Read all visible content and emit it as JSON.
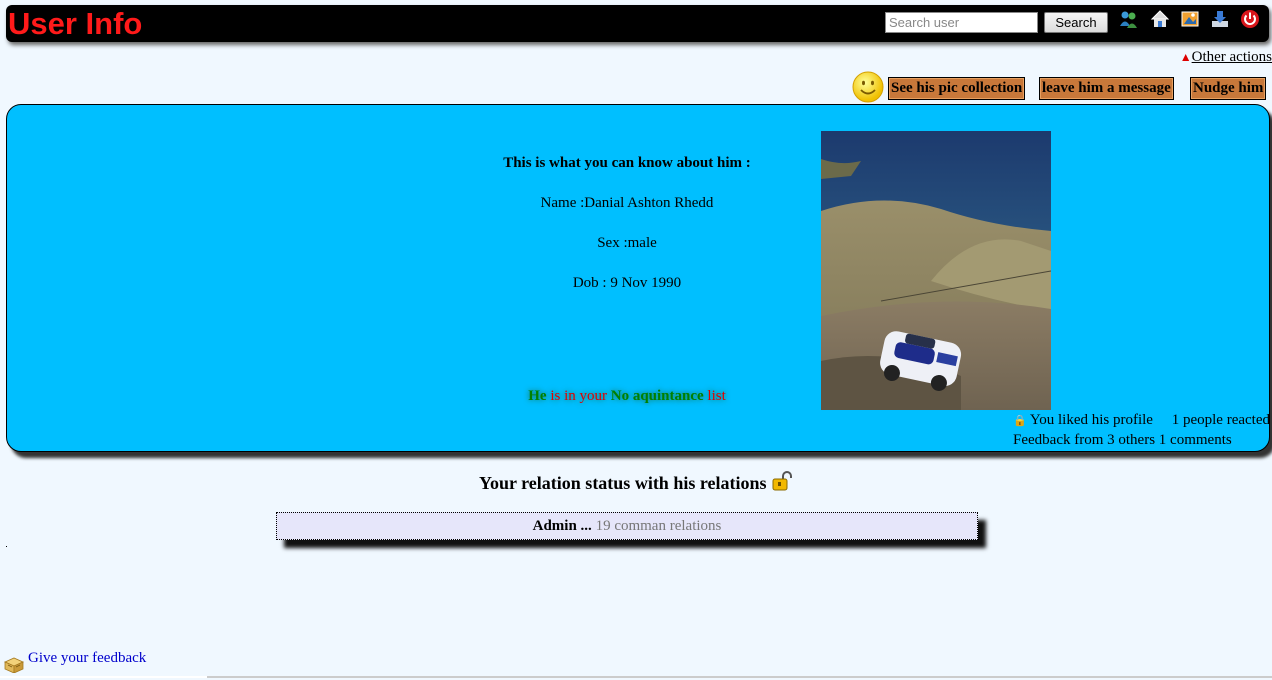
{
  "header": {
    "title": "User Info",
    "search_placeholder": "Search user",
    "search_label": "Search",
    "icons": [
      "users-icon",
      "home-icon",
      "photo-icon",
      "download-icon",
      "power-icon"
    ]
  },
  "other_actions": "Other actions",
  "actions": [
    "See his pic collection",
    "leave him a message",
    "Nudge him"
  ],
  "profile": {
    "heading": "This is what you can know about him :",
    "name": "Name :Danial Ashton Rhedd",
    "sex": "Sex :male",
    "dob": "Dob : 9 Nov 1990",
    "acquaintance": {
      "subject": "He",
      "mid": " is in your ",
      "list_name": "No aquintance",
      "end": " list"
    },
    "liked": "You liked his profile",
    "reacted": "1 people reacted",
    "feedback": "Feedback from 3 others 1 comments"
  },
  "relations": {
    "title": "Your relation status with his relations",
    "rows": [
      {
        "name": "Admin ...",
        "count": " 19 comman relations"
      }
    ]
  },
  "footer": {
    "feedback_link": "Give your feedback"
  },
  "colors": {
    "panel_bg": "#00bfff",
    "title_red": "#ff1a1a",
    "action_btn": "#c8783a",
    "page_bg": "#f0f8ff"
  }
}
